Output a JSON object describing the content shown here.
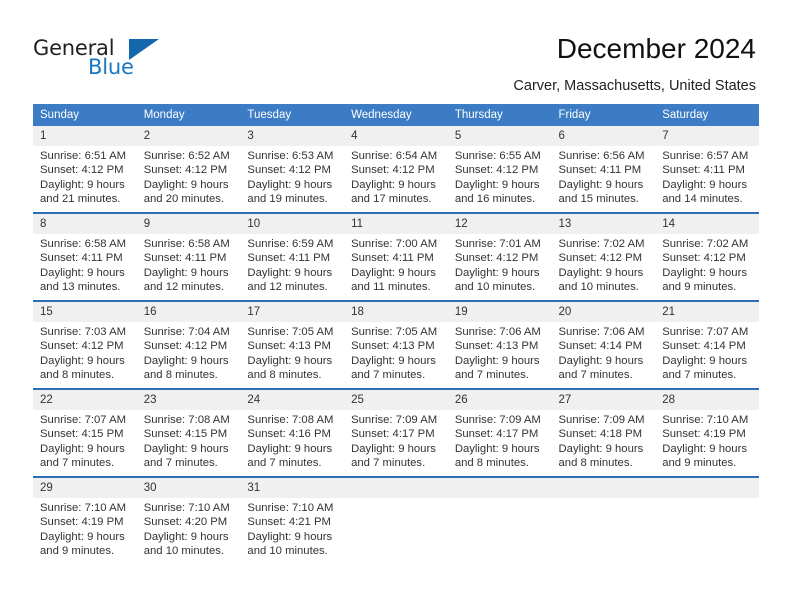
{
  "brand": {
    "name_part1": "General",
    "name_part2": "Blue",
    "triangle_icon": "triangle-icon",
    "accent_color": "#1c77c3",
    "triangle_color": "#1466ad"
  },
  "header": {
    "title": "December 2024",
    "subtitle": "Carver, Massachusetts, United States"
  },
  "calendar": {
    "header_bg_color": "#3b7cc4",
    "daynum_bg_color": "#f0f0f0",
    "week_separator_color": "#2f6fb5",
    "weekday_headers": [
      "Sunday",
      "Monday",
      "Tuesday",
      "Wednesday",
      "Thursday",
      "Friday",
      "Saturday"
    ],
    "weeks": [
      [
        {
          "day": "1",
          "sunrise": "Sunrise: 6:51 AM",
          "sunset": "Sunset: 4:12 PM",
          "daylight_line1": "Daylight: 9 hours",
          "daylight_line2": "and 21 minutes."
        },
        {
          "day": "2",
          "sunrise": "Sunrise: 6:52 AM",
          "sunset": "Sunset: 4:12 PM",
          "daylight_line1": "Daylight: 9 hours",
          "daylight_line2": "and 20 minutes."
        },
        {
          "day": "3",
          "sunrise": "Sunrise: 6:53 AM",
          "sunset": "Sunset: 4:12 PM",
          "daylight_line1": "Daylight: 9 hours",
          "daylight_line2": "and 19 minutes."
        },
        {
          "day": "4",
          "sunrise": "Sunrise: 6:54 AM",
          "sunset": "Sunset: 4:12 PM",
          "daylight_line1": "Daylight: 9 hours",
          "daylight_line2": "and 17 minutes."
        },
        {
          "day": "5",
          "sunrise": "Sunrise: 6:55 AM",
          "sunset": "Sunset: 4:12 PM",
          "daylight_line1": "Daylight: 9 hours",
          "daylight_line2": "and 16 minutes."
        },
        {
          "day": "6",
          "sunrise": "Sunrise: 6:56 AM",
          "sunset": "Sunset: 4:11 PM",
          "daylight_line1": "Daylight: 9 hours",
          "daylight_line2": "and 15 minutes."
        },
        {
          "day": "7",
          "sunrise": "Sunrise: 6:57 AM",
          "sunset": "Sunset: 4:11 PM",
          "daylight_line1": "Daylight: 9 hours",
          "daylight_line2": "and 14 minutes."
        }
      ],
      [
        {
          "day": "8",
          "sunrise": "Sunrise: 6:58 AM",
          "sunset": "Sunset: 4:11 PM",
          "daylight_line1": "Daylight: 9 hours",
          "daylight_line2": "and 13 minutes."
        },
        {
          "day": "9",
          "sunrise": "Sunrise: 6:58 AM",
          "sunset": "Sunset: 4:11 PM",
          "daylight_line1": "Daylight: 9 hours",
          "daylight_line2": "and 12 minutes."
        },
        {
          "day": "10",
          "sunrise": "Sunrise: 6:59 AM",
          "sunset": "Sunset: 4:11 PM",
          "daylight_line1": "Daylight: 9 hours",
          "daylight_line2": "and 12 minutes."
        },
        {
          "day": "11",
          "sunrise": "Sunrise: 7:00 AM",
          "sunset": "Sunset: 4:11 PM",
          "daylight_line1": "Daylight: 9 hours",
          "daylight_line2": "and 11 minutes."
        },
        {
          "day": "12",
          "sunrise": "Sunrise: 7:01 AM",
          "sunset": "Sunset: 4:12 PM",
          "daylight_line1": "Daylight: 9 hours",
          "daylight_line2": "and 10 minutes."
        },
        {
          "day": "13",
          "sunrise": "Sunrise: 7:02 AM",
          "sunset": "Sunset: 4:12 PM",
          "daylight_line1": "Daylight: 9 hours",
          "daylight_line2": "and 10 minutes."
        },
        {
          "day": "14",
          "sunrise": "Sunrise: 7:02 AM",
          "sunset": "Sunset: 4:12 PM",
          "daylight_line1": "Daylight: 9 hours",
          "daylight_line2": "and 9 minutes."
        }
      ],
      [
        {
          "day": "15",
          "sunrise": "Sunrise: 7:03 AM",
          "sunset": "Sunset: 4:12 PM",
          "daylight_line1": "Daylight: 9 hours",
          "daylight_line2": "and 8 minutes."
        },
        {
          "day": "16",
          "sunrise": "Sunrise: 7:04 AM",
          "sunset": "Sunset: 4:12 PM",
          "daylight_line1": "Daylight: 9 hours",
          "daylight_line2": "and 8 minutes."
        },
        {
          "day": "17",
          "sunrise": "Sunrise: 7:05 AM",
          "sunset": "Sunset: 4:13 PM",
          "daylight_line1": "Daylight: 9 hours",
          "daylight_line2": "and 8 minutes."
        },
        {
          "day": "18",
          "sunrise": "Sunrise: 7:05 AM",
          "sunset": "Sunset: 4:13 PM",
          "daylight_line1": "Daylight: 9 hours",
          "daylight_line2": "and 7 minutes."
        },
        {
          "day": "19",
          "sunrise": "Sunrise: 7:06 AM",
          "sunset": "Sunset: 4:13 PM",
          "daylight_line1": "Daylight: 9 hours",
          "daylight_line2": "and 7 minutes."
        },
        {
          "day": "20",
          "sunrise": "Sunrise: 7:06 AM",
          "sunset": "Sunset: 4:14 PM",
          "daylight_line1": "Daylight: 9 hours",
          "daylight_line2": "and 7 minutes."
        },
        {
          "day": "21",
          "sunrise": "Sunrise: 7:07 AM",
          "sunset": "Sunset: 4:14 PM",
          "daylight_line1": "Daylight: 9 hours",
          "daylight_line2": "and 7 minutes."
        }
      ],
      [
        {
          "day": "22",
          "sunrise": "Sunrise: 7:07 AM",
          "sunset": "Sunset: 4:15 PM",
          "daylight_line1": "Daylight: 9 hours",
          "daylight_line2": "and 7 minutes."
        },
        {
          "day": "23",
          "sunrise": "Sunrise: 7:08 AM",
          "sunset": "Sunset: 4:15 PM",
          "daylight_line1": "Daylight: 9 hours",
          "daylight_line2": "and 7 minutes."
        },
        {
          "day": "24",
          "sunrise": "Sunrise: 7:08 AM",
          "sunset": "Sunset: 4:16 PM",
          "daylight_line1": "Daylight: 9 hours",
          "daylight_line2": "and 7 minutes."
        },
        {
          "day": "25",
          "sunrise": "Sunrise: 7:09 AM",
          "sunset": "Sunset: 4:17 PM",
          "daylight_line1": "Daylight: 9 hours",
          "daylight_line2": "and 7 minutes."
        },
        {
          "day": "26",
          "sunrise": "Sunrise: 7:09 AM",
          "sunset": "Sunset: 4:17 PM",
          "daylight_line1": "Daylight: 9 hours",
          "daylight_line2": "and 8 minutes."
        },
        {
          "day": "27",
          "sunrise": "Sunrise: 7:09 AM",
          "sunset": "Sunset: 4:18 PM",
          "daylight_line1": "Daylight: 9 hours",
          "daylight_line2": "and 8 minutes."
        },
        {
          "day": "28",
          "sunrise": "Sunrise: 7:10 AM",
          "sunset": "Sunset: 4:19 PM",
          "daylight_line1": "Daylight: 9 hours",
          "daylight_line2": "and 9 minutes."
        }
      ],
      [
        {
          "day": "29",
          "sunrise": "Sunrise: 7:10 AM",
          "sunset": "Sunset: 4:19 PM",
          "daylight_line1": "Daylight: 9 hours",
          "daylight_line2": "and 9 minutes."
        },
        {
          "day": "30",
          "sunrise": "Sunrise: 7:10 AM",
          "sunset": "Sunset: 4:20 PM",
          "daylight_line1": "Daylight: 9 hours",
          "daylight_line2": "and 10 minutes."
        },
        {
          "day": "31",
          "sunrise": "Sunrise: 7:10 AM",
          "sunset": "Sunset: 4:21 PM",
          "daylight_line1": "Daylight: 9 hours",
          "daylight_line2": "and 10 minutes."
        },
        {
          "day": "",
          "sunrise": "",
          "sunset": "",
          "daylight_line1": "",
          "daylight_line2": ""
        },
        {
          "day": "",
          "sunrise": "",
          "sunset": "",
          "daylight_line1": "",
          "daylight_line2": ""
        },
        {
          "day": "",
          "sunrise": "",
          "sunset": "",
          "daylight_line1": "",
          "daylight_line2": ""
        },
        {
          "day": "",
          "sunrise": "",
          "sunset": "",
          "daylight_line1": "",
          "daylight_line2": ""
        }
      ]
    ]
  }
}
